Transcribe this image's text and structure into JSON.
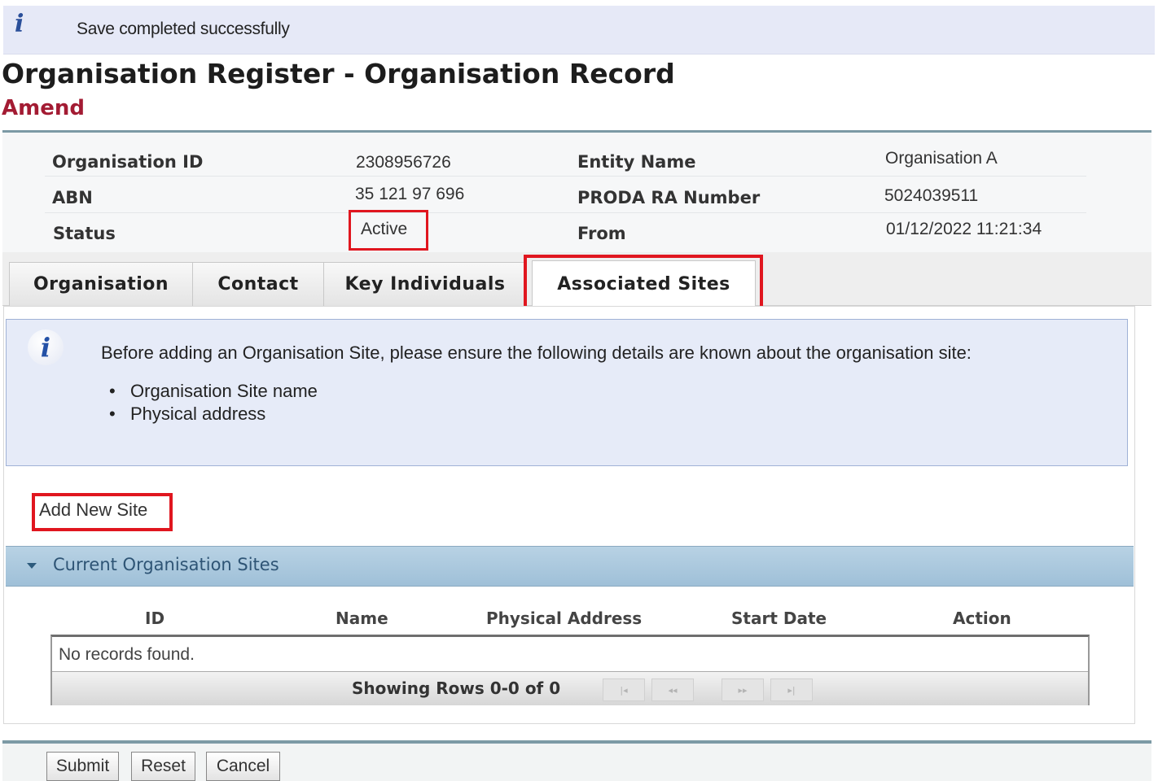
{
  "message_bar": {
    "icon": "info-icon",
    "text": "Save completed successfully"
  },
  "page": {
    "title": "Organisation Register - Organisation Record",
    "mode": "Amend"
  },
  "header": {
    "org_id_label": "Organisation ID",
    "org_id_value": "2308956726",
    "entity_name_label": "Entity Name",
    "entity_name_value": "Organisation A",
    "abn_label": "ABN",
    "abn_value": "35 121 97 696",
    "proda_label": "PRODA RA Number",
    "proda_value": "5024039511",
    "status_label": "Status",
    "status_value": "Active",
    "from_label": "From",
    "from_value": "01/12/2022 11:21:34"
  },
  "tabs": [
    {
      "label": "Organisation"
    },
    {
      "label": "Contact"
    },
    {
      "label": "Key Individuals"
    },
    {
      "label": "Associated Sites",
      "active": true
    }
  ],
  "notice": {
    "icon": "info-icon",
    "text": "Before adding an Organisation Site, please ensure the following details are known about the organisation site:",
    "items": [
      "Organisation Site name",
      "Physical address"
    ]
  },
  "add_site_link": "Add New Site",
  "sites_section": {
    "title": "Current Organisation Sites",
    "icon": "collapse-triangle-icon",
    "columns": [
      "ID",
      "Name",
      "Physical Address",
      "Start Date",
      "Action"
    ],
    "empty_text": "No records found.",
    "pager_text": "Showing Rows 0-0 of 0",
    "pager_buttons": [
      "first-page-icon",
      "prev-page-icon",
      "next-page-icon",
      "last-page-icon"
    ]
  },
  "footer_buttons": {
    "submit": "Submit",
    "reset": "Reset",
    "cancel": "Cancel"
  },
  "colors": {
    "highlight": "#e0161f",
    "mode_text": "#a31b33",
    "section_header": "#a9c8dd",
    "notice_bg": "#e6ebf8"
  }
}
